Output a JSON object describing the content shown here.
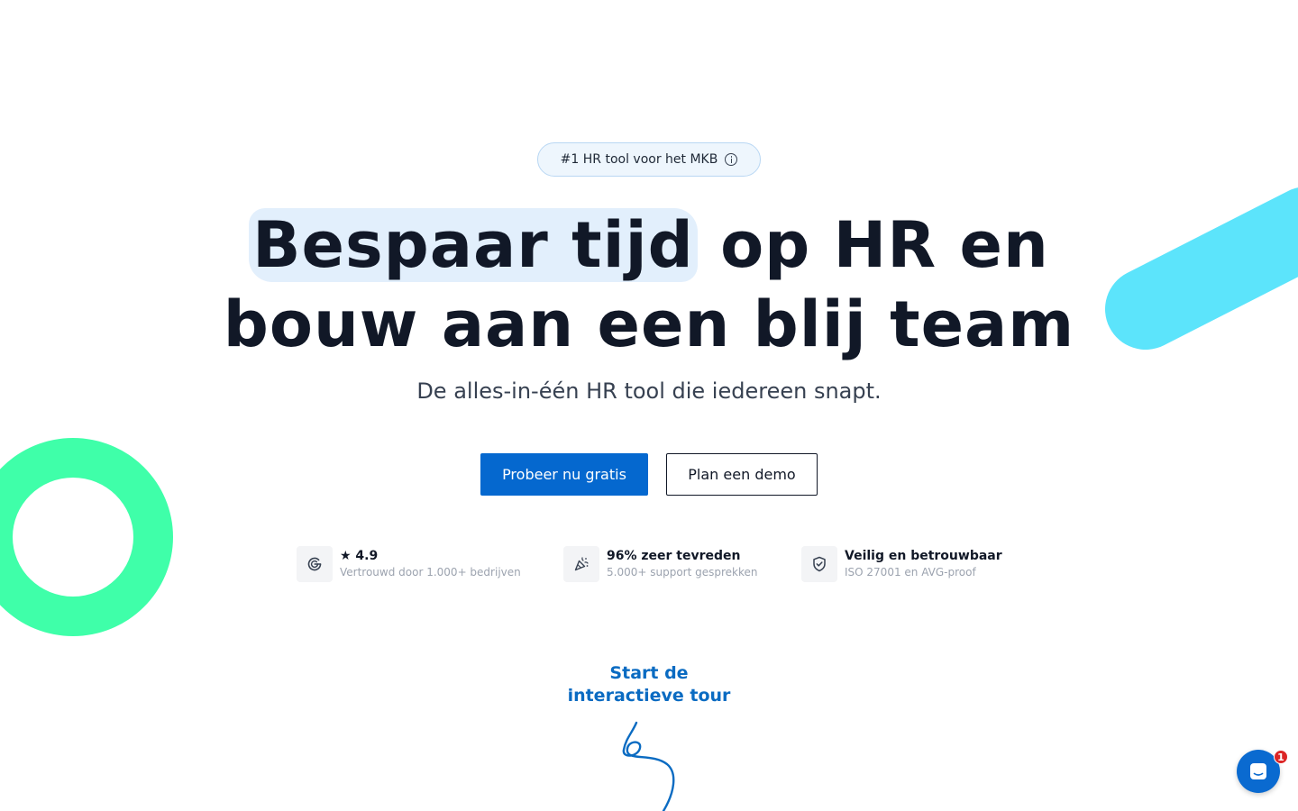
{
  "badge": {
    "label": "#1 HR tool voor het MKB"
  },
  "hero": {
    "title_highlight": "Bespaar tijd",
    "title_rest_line1": " op HR en",
    "title_line2": "bouw aan een blij team",
    "subtitle": "De alles-in-één HR tool die iedereen snapt."
  },
  "cta": {
    "primary_label": "Probeer nu gratis",
    "secondary_label": "Plan een demo"
  },
  "stats": [
    {
      "title": "★ 4.9",
      "subtitle": "Vertrouwd door 1.000+ bedrijven",
      "icon": "google-icon"
    },
    {
      "title": "96% zeer tevreden",
      "subtitle": "5.000+ support gesprekken",
      "icon": "party-popper-icon"
    },
    {
      "title": "Veilig en betrouwbaar",
      "subtitle": "ISO 27001 en AVG-proof",
      "icon": "shield-check-icon"
    }
  ],
  "tour": {
    "line1": "Start de",
    "line2": "interactieve tour"
  },
  "chat": {
    "unread_count": "1"
  },
  "colors": {
    "primary": "#0568cf",
    "highlight": "#e2effc",
    "stripe": "#5ce4fb",
    "ring": "#3fffa9",
    "tour_text": "#0a6bc2",
    "badge_bg": "#eef6fd"
  }
}
